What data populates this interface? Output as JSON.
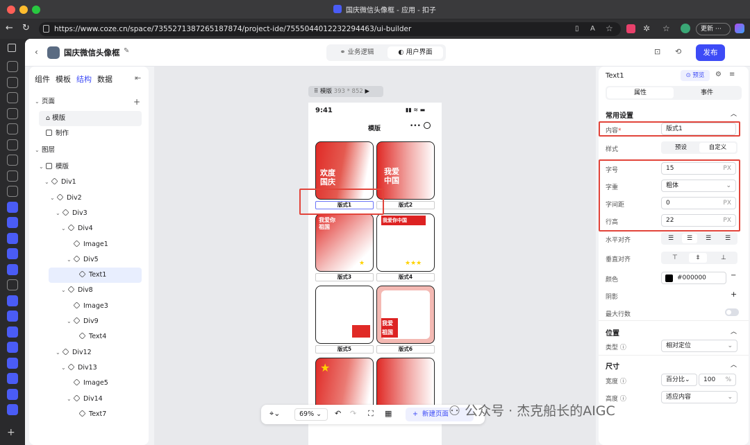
{
  "browser": {
    "tab_title": "国庆微信头像框 - 应用 - 扣子",
    "url": "https://www.coze.cn/space/7355271387265187874/project-ide/7555044012232294463/ui-builder",
    "update_label": "更新"
  },
  "header": {
    "project_title": "国庆微信头像框",
    "tab_logic": "业务逻辑",
    "tab_ui": "用户界面",
    "publish_label": "发布"
  },
  "left_panel": {
    "tabs": [
      "组件",
      "模板",
      "结构",
      "数据"
    ],
    "active_tab": "结构",
    "pages_label": "页面",
    "pages": [
      "模版",
      "制作"
    ],
    "layers_label": "图层",
    "layers": [
      "模版",
      "Div1",
      "Div2",
      "Div3",
      "Div4",
      "Image1",
      "Div5",
      "Text1",
      "Div8",
      "Image3",
      "Div9",
      "Text4",
      "Div12",
      "Div13",
      "Image5",
      "Div14",
      "Text7"
    ]
  },
  "canvas": {
    "frame_label": "模版",
    "frame_size": "393 * 852",
    "phone_time": "9:41",
    "phone_title": "模版",
    "captions": [
      "版式1",
      "版式2",
      "版式3",
      "版式4",
      "版式5",
      "版式6"
    ],
    "card_texts": [
      "欢度国庆",
      "我爱中国",
      "我爱你祖国",
      "我爱你中国",
      "我爱祖国"
    ],
    "zoom": "69%",
    "new_page_label": "新建页面"
  },
  "right_panel": {
    "element_name": "Text1",
    "preview_label": "预览",
    "tab_props": "属性",
    "tab_events": "事件",
    "section_common": "常用设置",
    "content_label": "内容",
    "content_value": "版式1",
    "style_label": "样式",
    "style_preset": "预设",
    "style_custom": "自定义",
    "font_size_label": "字号",
    "font_size_value": "15",
    "font_weight_label": "字重",
    "font_weight_value": "粗体",
    "letter_spacing_label": "字间距",
    "letter_spacing_value": "0",
    "line_height_label": "行高",
    "line_height_value": "22",
    "unit_px": "PX",
    "h_align_label": "水平对齐",
    "v_align_label": "垂直对齐",
    "color_label": "颜色",
    "color_value": "#000000",
    "shadow_label": "阴影",
    "max_lines_label": "最大行数",
    "section_position": "位置",
    "pos_type_label": "类型",
    "pos_type_value": "相对定位",
    "section_size": "尺寸",
    "width_label": "宽度",
    "width_unit": "百分比",
    "width_value": "100",
    "width_pct": "%",
    "height_label": "高度",
    "height_value": "适应内容"
  },
  "watermark": "公众号 · 杰克船长的AIGC",
  "colors": {
    "accent": "#3d4bf6",
    "highlight": "#e2443a",
    "festive_red": "#e02a26"
  }
}
